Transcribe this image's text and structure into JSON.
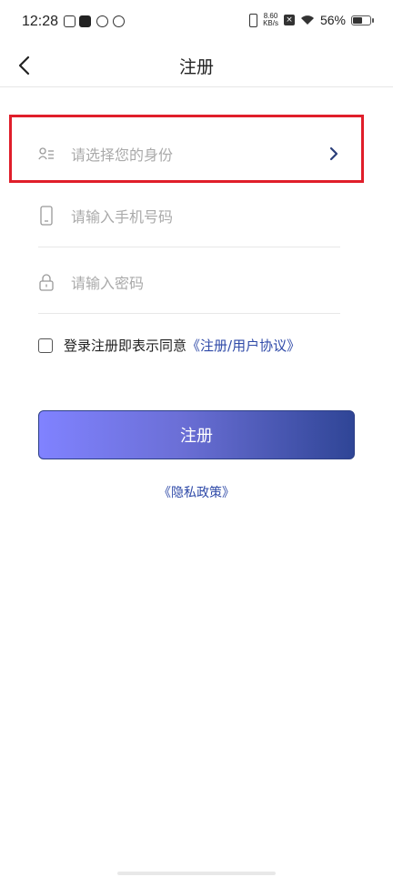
{
  "status_bar": {
    "time": "12:28",
    "net_speed_value": "8.60",
    "net_speed_unit": "KB/s",
    "battery_text": "56%",
    "battery_level": 0.56
  },
  "header": {
    "title": "注册"
  },
  "form": {
    "identity_placeholder": "请选择您的身份",
    "phone_placeholder": "请输入手机号码",
    "password_placeholder": "请输入密码",
    "agree_text": "登录注册即表示同意",
    "agree_link": "《注册/用户协议》",
    "checked": false
  },
  "actions": {
    "register_label": "注册",
    "privacy_link": "《隐私政策》"
  },
  "colors": {
    "accent": "#2f4aa8",
    "highlight": "#e01e2a",
    "button_gradient_start": "#8082ff",
    "button_gradient_end": "#2f4596"
  }
}
